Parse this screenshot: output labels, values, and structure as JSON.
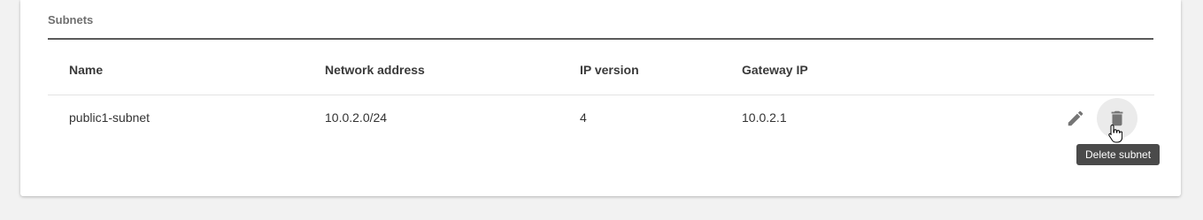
{
  "section": {
    "title": "Subnets"
  },
  "table": {
    "headers": [
      "Name",
      "Network address",
      "IP version",
      "Gateway IP"
    ],
    "rows": [
      {
        "name": "public1-subnet",
        "network_address": "10.0.2.0/24",
        "ip_version": "4",
        "gateway_ip": "10.0.2.1"
      }
    ]
  },
  "actions": {
    "edit_icon": "pencil-icon",
    "delete_icon": "trash-icon",
    "delete_tooltip": "Delete subnet"
  },
  "colors": {
    "icon": "#757575",
    "tooltip_bg": "#4a4a4a",
    "hover_circle": "#ebebeb"
  }
}
